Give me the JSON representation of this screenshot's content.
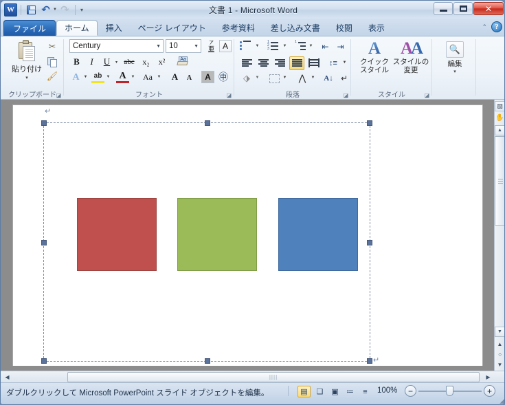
{
  "window": {
    "title": "文書 1 - Microsoft Word",
    "minimize_label": "最小化",
    "maximize_label": "最大化",
    "close_label": "✕"
  },
  "quick_access": {
    "logo_label": "W",
    "save_label": "上書き保存",
    "undo_label": "元に戻す",
    "redo_label": "やり直し",
    "customize_label": "▾"
  },
  "tabs": [
    {
      "label": "ファイル",
      "kind": "file"
    },
    {
      "label": "ホーム",
      "kind": "active"
    },
    {
      "label": "挿入",
      "kind": "normal"
    },
    {
      "label": "ページ レイアウト",
      "kind": "normal"
    },
    {
      "label": "参考資料",
      "kind": "normal"
    },
    {
      "label": "差し込み文書",
      "kind": "normal"
    },
    {
      "label": "校閲",
      "kind": "normal"
    },
    {
      "label": "表示",
      "kind": "normal"
    }
  ],
  "tab_right": {
    "minimize_ribbon": "⌃",
    "help": "?"
  },
  "ribbon": {
    "clipboard": {
      "label": "クリップボード",
      "paste_label": "貼り付け",
      "paste_dropdown": "▾",
      "cut_label": "切り取り",
      "copy_label": "コピー",
      "format_painter_label": "書式のコピー/貼り付け",
      "dialog_launcher": "◪"
    },
    "font": {
      "label": "フォント",
      "font_name": "Century",
      "font_size": "10",
      "phonetic_guide_label": "ルビ",
      "char_border_label": "囲み線",
      "bold": "B",
      "italic": "I",
      "underline": "U",
      "underline_dropdown": "▾",
      "strikethrough": "abc",
      "subscript": "x₂",
      "superscript": "x²",
      "clear_format_label": "書式のクリア",
      "text_effects": "A",
      "highlight": "ab",
      "font_color": "A",
      "change_case": "Aa",
      "grow_font": "A",
      "shrink_font": "A",
      "char_shading_label": "文字の網かけ",
      "enclose_char_label": "囲い文字",
      "dialog_launcher": "◪"
    },
    "paragraph": {
      "label": "段落",
      "bullets_label": "箇条書き",
      "numbering_label": "段落番号",
      "multilevel_label": "アウトライン",
      "decrease_indent_label": "インデントを減らす",
      "increase_indent_label": "インデントを増やす",
      "align_left_label": "左揃え",
      "align_center_label": "中央揃え",
      "align_right_label": "右揃え",
      "justify_label": "両端揃え",
      "distribute_label": "均等割り付け",
      "line_spacing_label": "行間",
      "shading_label": "塗りつぶし",
      "borders_label": "罫線",
      "phonetic_label": "拡張書式",
      "sort_label": "並べ替え",
      "show_marks_label": "編集記号の表示/非表示",
      "dialog_launcher": "◪"
    },
    "styles": {
      "label": "スタイル",
      "quick_styles_line1": "クイック",
      "quick_styles_line2": "スタイル",
      "quick_styles_arrow": "▾",
      "change_styles_line1": "スタイルの",
      "change_styles_line2": "変更",
      "change_styles_arrow": "▾",
      "dialog_launcher": "◪"
    },
    "editing": {
      "label": "編集",
      "arrow": "▾",
      "icon_label": "検索と置換"
    }
  },
  "document": {
    "paragraph_mark_top": "↵",
    "paragraph_mark_after_object": "↵",
    "object": {
      "type": "PowerPoint スライド オブジェクト",
      "shapes": [
        {
          "name": "red-rectangle",
          "color": "#C0504D",
          "border": "#9E4340"
        },
        {
          "name": "green-rectangle",
          "color": "#9BBB59",
          "border": "#7F9C47"
        },
        {
          "name": "blue-rectangle",
          "color": "#4F81BD",
          "border": "#3F6A9E"
        }
      ]
    }
  },
  "scrollbars": {
    "ruler_toggle_label": "ルーラー",
    "hand_tool_label": "ハンド",
    "scroll_up": "▲",
    "scroll_down": "▼",
    "scroll_left": "◀",
    "scroll_right": "▶",
    "browse_prev": "▲",
    "browse_object": "○",
    "browse_next": "▼",
    "hthumb_grip": "||||"
  },
  "status": {
    "message": "ダブルクリックして Microsoft PowerPoint スライド オブジェクトを編集。",
    "views": [
      {
        "name": "print-layout",
        "glyph": "▤",
        "active": true
      },
      {
        "name": "full-screen-reading",
        "glyph": "❏",
        "active": false
      },
      {
        "name": "web-layout",
        "glyph": "▣",
        "active": false
      },
      {
        "name": "outline",
        "glyph": "≔",
        "active": false
      },
      {
        "name": "draft",
        "glyph": "≡",
        "active": false
      }
    ],
    "zoom_level": "100%",
    "zoom_out": "−",
    "zoom_in": "+"
  }
}
